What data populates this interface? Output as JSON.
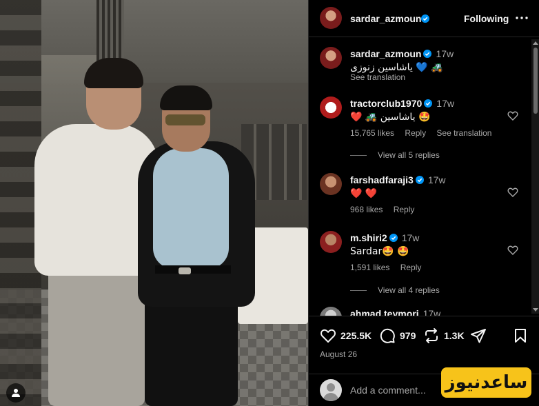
{
  "post": {
    "author": "sardar_azmoun",
    "follow_state": "Following",
    "more_icon": "more-horizontal-icon",
    "caption": {
      "username": "sardar_azmoun",
      "time": "17w",
      "text": "یاشاسین زنوزی 💙 🚜",
      "translation": "See translation"
    }
  },
  "comments": [
    {
      "username": "tractorclub1970",
      "verified": true,
      "time": "17w",
      "text": "❤️ 🚜 یاشاسین 🤩",
      "likes": "15,765 likes",
      "reply": "Reply",
      "translation": "See translation",
      "view_replies": "View all 5 replies"
    },
    {
      "username": "farshadfaraji3",
      "verified": true,
      "time": "17w",
      "text": "❤️ ❤️",
      "likes": "968 likes",
      "reply": "Reply"
    },
    {
      "username": "m.shiri2",
      "verified": true,
      "time": "17w",
      "text": "Sardar🤩 🤩",
      "likes": "1,591 likes",
      "reply": "Reply",
      "view_replies": "View all 4 replies"
    },
    {
      "username": "ahmad.teymori",
      "time": "17w"
    }
  ],
  "actions": {
    "like_count": "225.5K",
    "comment_count": "979",
    "repost_count": "1.3K",
    "date": "August 26"
  },
  "add_comment": {
    "placeholder": "Add a comment..."
  },
  "watermark": "ساعدنیوز",
  "colors": {
    "background": "#000000",
    "verified": "#0095f6",
    "muted_text": "#a8a8a8",
    "watermark_bg": "#f7c31a"
  }
}
